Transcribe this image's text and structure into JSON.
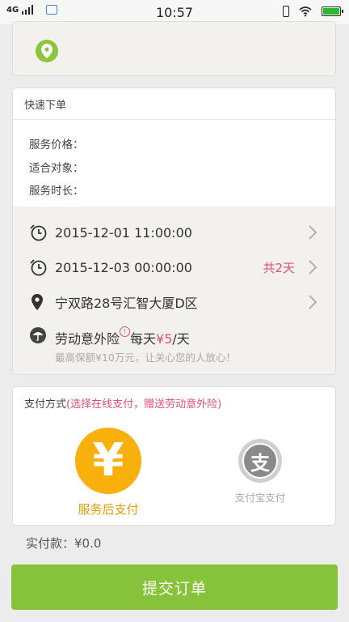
{
  "status_bar": {
    "network": "4G",
    "time": "10:57"
  },
  "order_card": {
    "title": "快速下单",
    "price_label": "服务价格：",
    "target_label": "适合对象：",
    "duration_label": "服务时长：",
    "start_time": "2015-12-01 11:00:00",
    "end_time": "2015-12-03 00:00:00",
    "days": "共2天",
    "address": "宁双路28号汇智大厦D区",
    "insurance": {
      "name": "劳动意外险",
      "alert_mark": "!",
      "per_day": "每天",
      "price": "¥5",
      "unit": "/天",
      "note": "最高保额¥10万元，让关心您的人放心！"
    }
  },
  "payment": {
    "title": "支付方式",
    "title_note": "(选择在线支付，赠送劳动意外险)",
    "option_after": {
      "symbol": "¥",
      "label": "服务后支付"
    },
    "option_alipay": {
      "symbol": "支",
      "label": "支付宝支付"
    }
  },
  "amount": "实付款：¥0.0",
  "submit_label": "提交订单",
  "colors": {
    "accent_green": "#86c33b",
    "pink": "#e04f7a",
    "orange": "#f8b00c"
  }
}
